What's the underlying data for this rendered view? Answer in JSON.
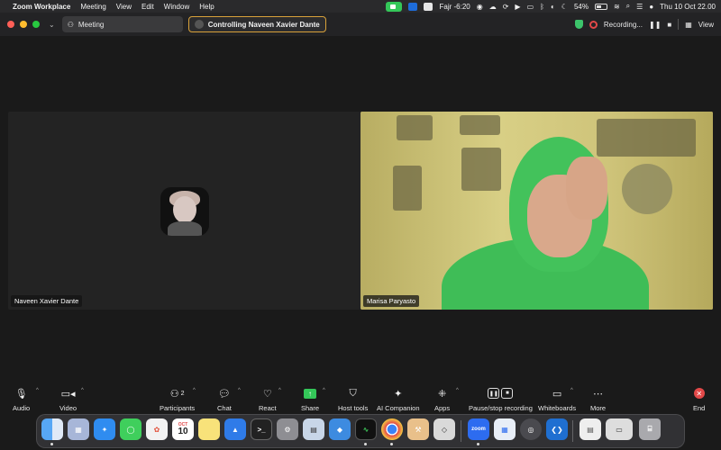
{
  "menubar": {
    "app": "Zoom Workplace",
    "items": [
      "Meeting",
      "View",
      "Edit",
      "Window",
      "Help"
    ],
    "prayer": "Fajr -6:20",
    "battery": "54%",
    "battery_level": 0.54,
    "datetime": "Thu 10 Oct  22.00"
  },
  "titlebar": {
    "meeting_tab": "Meeting",
    "control_tab": "Controlling Naveen Xavier Dante",
    "recording": "Recording...",
    "view": "View"
  },
  "participants": {
    "left_name": "Naveen Xavier Dante",
    "right_name": "Marisa Paryasto"
  },
  "toolbar": {
    "audio": "Audio",
    "video": "Video",
    "participants": "Participants",
    "participants_count": "2",
    "chat": "Chat",
    "react": "React",
    "share": "Share",
    "host_tools": "Host tools",
    "ai_companion": "AI Companion",
    "apps": "Apps",
    "pause_recording": "Pause/stop recording",
    "whiteboards": "Whiteboards",
    "more": "More",
    "end": "End"
  },
  "dock": {
    "calendar_month": "OCT",
    "calendar_day": "10",
    "zoom_label": "zoom",
    "icons": [
      "finder-icon",
      "launchpad-icon",
      "safari-icon",
      "messages-icon",
      "photos-icon",
      "calendar-icon",
      "notes-icon",
      "keynote-icon",
      "terminal-icon",
      "system-settings-icon",
      "preview-icon",
      "cube-icon",
      "activity-monitor-icon",
      "chrome-icon",
      "xcode-icon",
      "roblox-icon",
      "zoom-icon",
      "finder-files-icon",
      "quicktime-icon",
      "vscode-icon",
      "document-icon",
      "window-icon",
      "trash-icon"
    ]
  },
  "colors": {
    "accent_green": "#34c759",
    "end_red": "#e24848",
    "control_outline": "#d9a23a"
  }
}
